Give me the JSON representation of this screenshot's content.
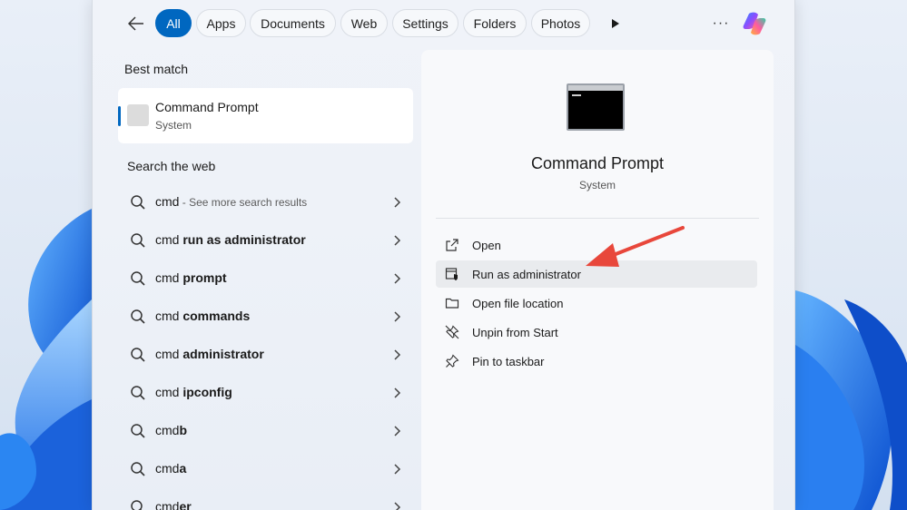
{
  "filters": {
    "back_label": "",
    "chips": [
      "All",
      "Apps",
      "Documents",
      "Web",
      "Settings",
      "Folders",
      "Photos"
    ],
    "active": "All",
    "more_glyph": "···"
  },
  "best_match": {
    "heading": "Best match",
    "name": "Command Prompt",
    "type": "System"
  },
  "search_web": {
    "heading": "Search the web",
    "results": [
      {
        "prefix": "cmd",
        "bold": "",
        "hint": " - See more search results"
      },
      {
        "prefix": "cmd ",
        "bold": "run as administrator",
        "hint": ""
      },
      {
        "prefix": "cmd ",
        "bold": "prompt",
        "hint": ""
      },
      {
        "prefix": "cmd ",
        "bold": "commands",
        "hint": ""
      },
      {
        "prefix": "cmd ",
        "bold": "administrator",
        "hint": ""
      },
      {
        "prefix": "cmd ",
        "bold": "ipconfig",
        "hint": ""
      },
      {
        "prefix": "cmd",
        "bold": "b",
        "hint": ""
      },
      {
        "prefix": "cmd",
        "bold": "a",
        "hint": ""
      },
      {
        "prefix": "cmd",
        "bold": "er",
        "hint": ""
      }
    ]
  },
  "preview": {
    "title": "Command Prompt",
    "subtitle": "System",
    "actions": [
      {
        "label": "Open",
        "icon": "open-external-icon"
      },
      {
        "label": "Run as administrator",
        "icon": "shield-admin-icon"
      },
      {
        "label": "Open file location",
        "icon": "folder-icon"
      },
      {
        "label": "Unpin from Start",
        "icon": "unpin-icon"
      },
      {
        "label": "Pin to taskbar",
        "icon": "pin-icon"
      }
    ],
    "highlighted_action": "Run as administrator"
  },
  "colors": {
    "accent": "#0067c0",
    "annotation_arrow": "#e8473b"
  }
}
